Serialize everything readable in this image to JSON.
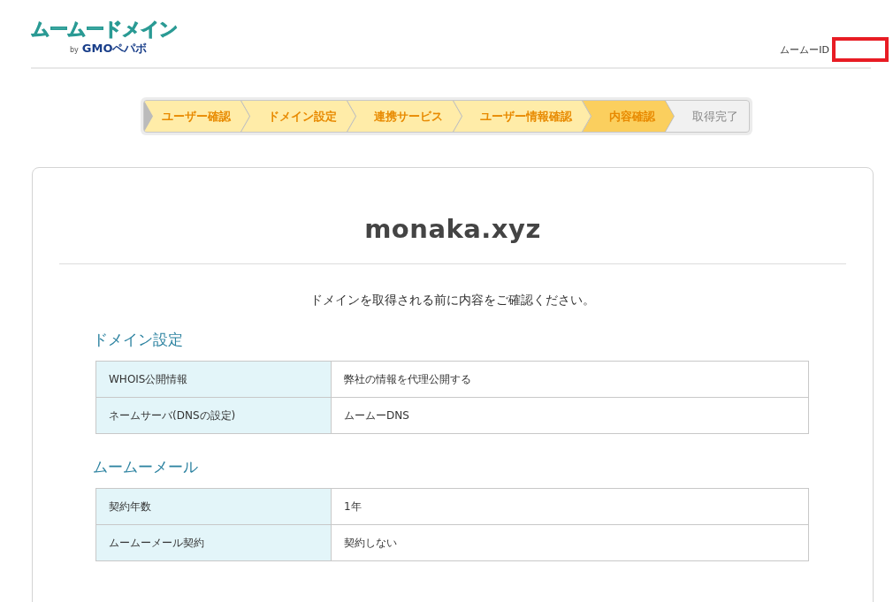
{
  "header": {
    "logo": "ムームードメイン",
    "logo_by": "by",
    "logo_brand": "GMOペパボ",
    "id_label": "ムームーID"
  },
  "steps": [
    {
      "label": "ユーザー確認",
      "selected": false,
      "completed": true
    },
    {
      "label": "ドメイン設定",
      "selected": false,
      "completed": true
    },
    {
      "label": "連携サービス",
      "selected": false,
      "completed": true
    },
    {
      "label": "ユーザー情報確認",
      "selected": false,
      "completed": true
    },
    {
      "label": "内容確認",
      "selected": true,
      "completed": true
    },
    {
      "label": "取得完了",
      "selected": false,
      "completed": false
    }
  ],
  "domain": "monaka.xyz",
  "intro": "ドメインを取得される前に内容をご確認ください。",
  "sections": [
    {
      "title": "ドメイン設定",
      "rows": [
        {
          "label": "WHOIS公開情報",
          "value": "弊社の情報を代理公開する"
        },
        {
          "label": "ネームサーバ(DNSの設定)",
          "value": "ムームーDNS"
        }
      ]
    },
    {
      "title": "ムームーメール",
      "rows": [
        {
          "label": "契約年数",
          "value": "1年"
        },
        {
          "label": "ムームーメール契約",
          "value": "契約しない"
        }
      ]
    }
  ]
}
